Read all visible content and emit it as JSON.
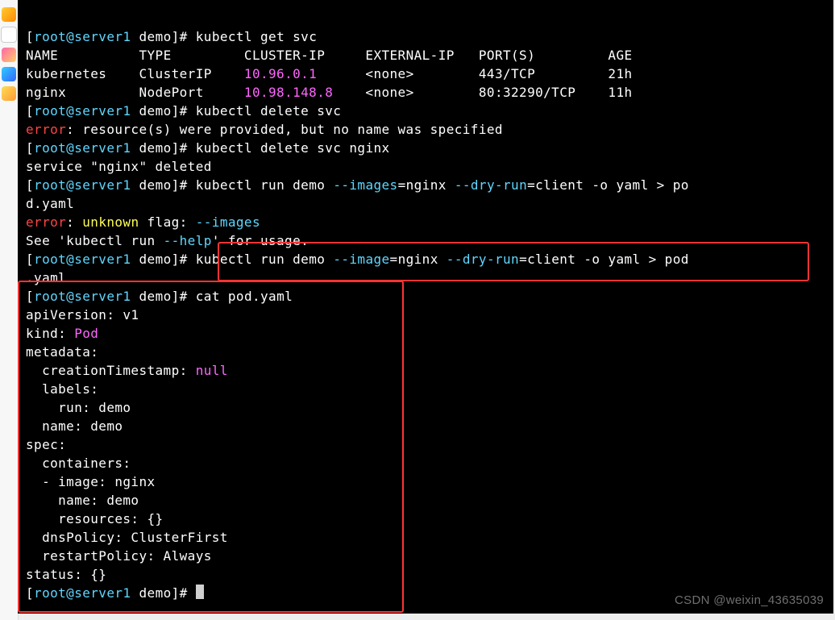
{
  "sidebar_icons": [
    "tab1",
    "tab2",
    "tab3",
    "tab4",
    "tab5"
  ],
  "prompt": {
    "open": "[",
    "user_host": "root@server1",
    "sep": " ",
    "cwd": "demo",
    "close": "]# "
  },
  "cmds": {
    "get_svc": "kubectl get svc",
    "del_svc": "kubectl delete svc",
    "del_svc_nginx": "kubectl delete svc nginx",
    "run_bad_1": "kubectl run demo ",
    "run_bad_flag": "--images",
    "run_bad_2": "=nginx ",
    "run_bad_dry": "--dry-run",
    "run_bad_3": "=client -o yaml > po",
    "run_bad_4": "d.yaml",
    "run_good_1": "kubectl run demo ",
    "run_good_flag": "--image",
    "run_good_2": "=nginx ",
    "run_good_dry": "--dry-run",
    "run_good_3": "=client -o yaml > pod",
    "run_good_4": ".yaml",
    "cat": "cat pod.yaml"
  },
  "svc_header": {
    "name": "NAME",
    "type": "TYPE",
    "cip": "CLUSTER-IP",
    "eip": "EXTERNAL-IP",
    "ports": "PORT(S)",
    "age": "AGE"
  },
  "svc_rows": [
    {
      "name": "kubernetes",
      "type": "ClusterIP",
      "cip": "10.96.0.1",
      "eip": "<none>",
      "ports": "443/TCP",
      "age": "21h"
    },
    {
      "name": "nginx",
      "type": "NodePort",
      "cip": "10.98.148.8",
      "eip": "<none>",
      "ports": "80:32290/TCP",
      "age": "11h"
    }
  ],
  "msgs": {
    "err_noname_pre": "error",
    "err_noname": ": resource(s) were provided, but no name was specified",
    "deleted": "service \"nginx\" deleted",
    "err_unknown_pre": "error",
    "err_unknown_mid": ": ",
    "err_unknown_flag": "unknown",
    "err_unknown_rest": " flag: ",
    "err_unknown_arg": "--images",
    "see_help_1": "See 'kubectl run ",
    "see_help_flag": "--help",
    "see_help_2": "' for usage."
  },
  "yaml": {
    "l1": "apiVersion: v1",
    "l2_k": "kind:",
    "l2_v": " Pod",
    "l3": "metadata:",
    "l4_k": "  creationTimestamp:",
    "l4_v": " null",
    "l5": "  labels:",
    "l6": "    run: demo",
    "l7": "  name: demo",
    "l8": "spec:",
    "l9": "  containers:",
    "l10": "  - image: nginx",
    "l11": "    name: demo",
    "l12": "    resources: {}",
    "l13": "  dnsPolicy: ClusterFirst",
    "l14": "  restartPolicy: Always",
    "l15": "status: {}"
  },
  "watermark": "CSDN @weixin_43635039",
  "pad": {
    "h_name": "NAME          ",
    "h_type": "TYPE         ",
    "h_cip": "CLUSTER-IP     ",
    "h_eip": "EXTERNAL-IP   ",
    "h_ports": "PORT(S)         ",
    "r0_name": "kubernetes    ",
    "r0_type": "ClusterIP    ",
    "r0_cip": "10.96.0.1      ",
    "r0_eip": "<none>        ",
    "r0_ports": "443/TCP         ",
    "r1_name": "nginx         ",
    "r1_type": "NodePort     ",
    "r1_cip": "10.98.148.8    ",
    "r1_eip": "<none>        ",
    "r1_ports": "80:32290/TCP    "
  }
}
